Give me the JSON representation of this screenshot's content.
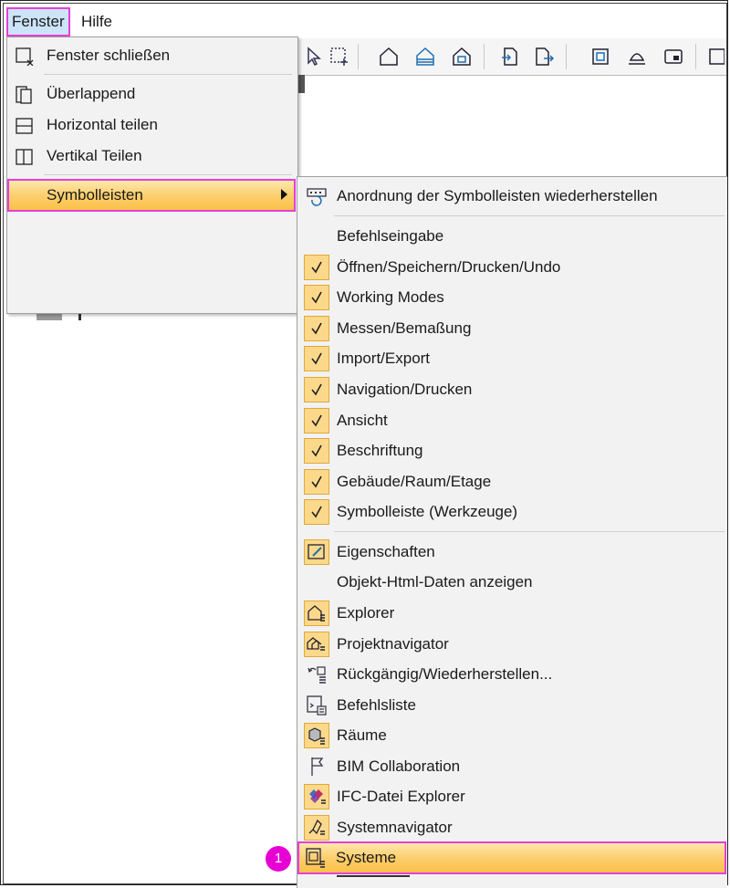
{
  "menubar": {
    "fenster": "Fenster",
    "hilfe": "Hilfe"
  },
  "fenster_menu": {
    "items": [
      {
        "label": "Fenster schließen",
        "icon": "close-window-icon"
      },
      {
        "label": "Überlappend",
        "icon": "cascade-icon"
      },
      {
        "label": "Horizontal teilen",
        "icon": "split-horizontal-icon"
      },
      {
        "label": "Vertikal Teilen",
        "icon": "split-vertical-icon"
      },
      {
        "label": "Symbolleisten",
        "icon": "",
        "submenu": true
      }
    ]
  },
  "toolbar_submenu": {
    "items": [
      {
        "label": "Anordnung der Symbolleisten wiederherstellen",
        "icon": "toolbar-reset-icon",
        "checked": false
      },
      {
        "label": "Befehlseingabe",
        "icon": "",
        "checked": false
      },
      {
        "label": "Öffnen/Speichern/Drucken/Undo",
        "icon": "checkmark-icon",
        "checked": true
      },
      {
        "label": "Working Modes",
        "icon": "checkmark-icon",
        "checked": true
      },
      {
        "label": "Messen/Bemaßung",
        "icon": "checkmark-icon",
        "checked": true
      },
      {
        "label": "Import/Export",
        "icon": "checkmark-icon",
        "checked": true
      },
      {
        "label": "Navigation/Drucken",
        "icon": "checkmark-icon",
        "checked": true
      },
      {
        "label": "Ansicht",
        "icon": "checkmark-icon",
        "checked": true
      },
      {
        "label": "Beschriftung",
        "icon": "checkmark-icon",
        "checked": true
      },
      {
        "label": "Gebäude/Raum/Etage",
        "icon": "checkmark-icon",
        "checked": true
      },
      {
        "label": "Symbolleiste (Werkzeuge)",
        "icon": "checkmark-icon",
        "checked": true
      },
      {
        "label": "Eigenschaften",
        "icon": "properties-icon",
        "checked": true
      },
      {
        "label": "Objekt-Html-Daten anzeigen",
        "icon": "",
        "checked": false
      },
      {
        "label": "Explorer",
        "icon": "explorer-icon",
        "checked": true
      },
      {
        "label": "Projektnavigator",
        "icon": "project-navigator-icon",
        "checked": true
      },
      {
        "label": "Rückgängig/Wiederherstellen...",
        "icon": "undo-redo-icon",
        "checked": false
      },
      {
        "label": "Befehlsliste",
        "icon": "command-list-icon",
        "checked": false
      },
      {
        "label": "Räume",
        "icon": "rooms-icon",
        "checked": true
      },
      {
        "label": "BIM Collaboration",
        "icon": "flag-icon",
        "checked": false
      },
      {
        "label": "IFC-Datei Explorer",
        "icon": "ifc-explorer-icon",
        "checked": true
      },
      {
        "label": "Systemnavigator",
        "icon": "system-navigator-icon",
        "checked": true
      },
      {
        "label": "Systeme",
        "icon": "systems-icon",
        "checked": false
      }
    ]
  },
  "callout": {
    "number": "1"
  },
  "colors": {
    "highlight_outline": "#e43fd9",
    "check_bg": "#fcd98a",
    "menu_bg": "#f2f2f2"
  }
}
